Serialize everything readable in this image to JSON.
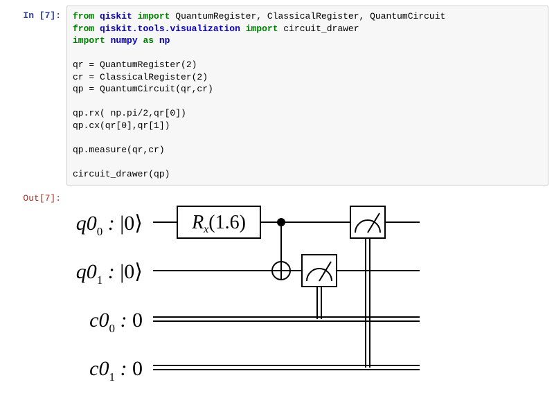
{
  "notebook": {
    "cell_index": "7",
    "in_prompt": "In [7]:",
    "out_prompt": "Out[7]:",
    "code": {
      "l1_from": "from",
      "l1_mod": "qiskit",
      "l1_import": "import",
      "l1_rest": " QuantumRegister, ClassicalRegister, QuantumCircuit",
      "l2_from": "from",
      "l2_mod": "qiskit.tools.visualization",
      "l2_import": "import",
      "l2_rest": " circuit_drawer",
      "l3_import": "import",
      "l3_mod": "numpy",
      "l3_as": "as",
      "l3_alias": "np",
      "l5": "qr = QuantumRegister(2)",
      "l6": "cr = ClassicalRegister(2)",
      "l7": "qp = QuantumCircuit(qr,cr)",
      "l9": "qp.rx( np.pi/2,qr[0])",
      "l10": "qp.cx(qr[0],qr[1])",
      "l12": "qp.measure(qr,cr)",
      "l14": "circuit_drawer(qp)"
    }
  },
  "circuit": {
    "wires": [
      {
        "label_main": "q0",
        "label_sub": "0",
        "state": "|0⟩",
        "type": "quantum"
      },
      {
        "label_main": "q0",
        "label_sub": "1",
        "state": "|0⟩",
        "type": "quantum"
      },
      {
        "label_main": "c0",
        "label_sub": "0",
        "state": "0",
        "type": "classical"
      },
      {
        "label_main": "c0",
        "label_sub": "1",
        "state": "0",
        "type": "classical"
      }
    ],
    "gate_label_main": "R",
    "gate_label_sub": "x",
    "gate_label_arg": "(1.6)"
  },
  "chart_data": {
    "type": "table",
    "title": "Quantum circuit",
    "rows": [
      {
        "wire": "q0_0",
        "init": "|0>",
        "ops": [
          "Rx(1.6)",
          "CNOT control",
          "measure -> c0_1"
        ]
      },
      {
        "wire": "q0_1",
        "init": "|0>",
        "ops": [
          "CNOT target",
          "measure -> c0_0"
        ]
      },
      {
        "wire": "c0_0",
        "init": "0",
        "ops": [
          "receives measure(q0_1)"
        ]
      },
      {
        "wire": "c0_1",
        "init": "0",
        "ops": [
          "receives measure(q0_0)"
        ]
      }
    ]
  }
}
